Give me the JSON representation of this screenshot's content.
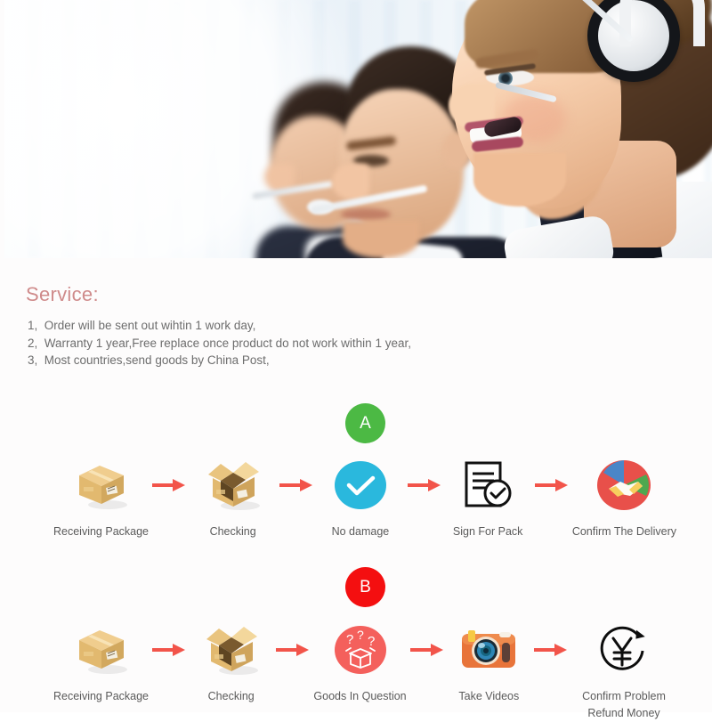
{
  "hero": {
    "alt": "call center agents wearing headsets",
    "icon": "headset-photo"
  },
  "service": {
    "title": "Service:",
    "title_color": "#cf8b8b",
    "lines": [
      "1,  Order will be sent out wihtin 1 work day,",
      "2,  Warranty 1 year,Free replace once product do not work within 1 year,",
      "3,  Most countries,send goods by China Post,"
    ]
  },
  "flows": [
    {
      "badge": "A",
      "badge_color": "#4cb944",
      "arrow_color": "#f2544a",
      "steps": [
        {
          "label": "Receiving Package",
          "icon": "closed-box-icon"
        },
        {
          "label": "Checking",
          "icon": "open-box-icon"
        },
        {
          "label": "No damage",
          "icon": "blue-check-circle-icon"
        },
        {
          "label": "Sign For Pack",
          "icon": "document-check-icon"
        },
        {
          "label": "Confirm The Delivery",
          "icon": "handshake-circle-icon"
        }
      ]
    },
    {
      "badge": "B",
      "badge_color": "#f40f10",
      "arrow_color": "#f2544a",
      "steps": [
        {
          "label": "Receiving Package",
          "icon": "closed-box-icon"
        },
        {
          "label": "Checking",
          "icon": "open-box-icon"
        },
        {
          "label": "Goods In Question",
          "icon": "question-box-circle-icon"
        },
        {
          "label": "Take Videos",
          "icon": "camera-icon"
        },
        {
          "label": "Confirm Problem Refund Money",
          "icon": "yen-refund-icon"
        }
      ]
    }
  ]
}
